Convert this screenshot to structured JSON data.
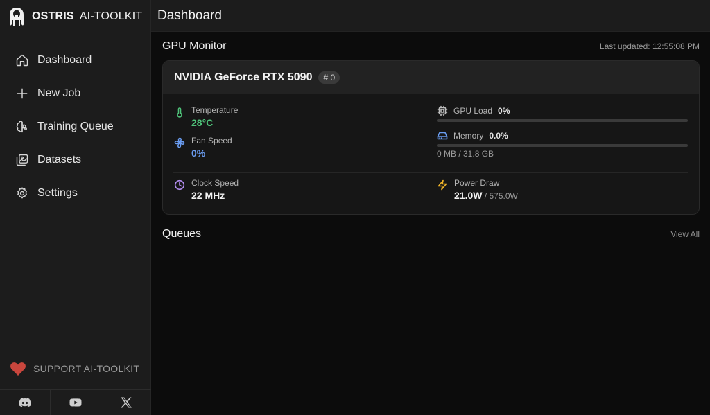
{
  "brand": {
    "name": "OSTRIS",
    "sub": "AI-TOOLKIT"
  },
  "header": {
    "title": "Dashboard"
  },
  "sidebar": {
    "items": [
      {
        "label": "Dashboard",
        "icon": "home-icon"
      },
      {
        "label": "New Job",
        "icon": "plus-icon"
      },
      {
        "label": "Training Queue",
        "icon": "brain-icon"
      },
      {
        "label": "Datasets",
        "icon": "images-icon"
      },
      {
        "label": "Settings",
        "icon": "gear-icon"
      }
    ],
    "support_label": "SUPPORT AI-TOOLKIT",
    "footer_icons": [
      "discord-icon",
      "youtube-icon",
      "x-icon"
    ]
  },
  "gpu_monitor": {
    "title": "GPU Monitor",
    "last_updated": "Last updated: 12:55:08 PM",
    "gpu": {
      "name": "NVIDIA GeForce RTX 5090",
      "index_badge": "# 0",
      "temperature": {
        "label": "Temperature",
        "value": "28°C"
      },
      "fan_speed": {
        "label": "Fan Speed",
        "value": "0%"
      },
      "gpu_load": {
        "label": "GPU Load",
        "value": "0%",
        "fraction": 0.0
      },
      "memory": {
        "label": "Memory",
        "value": "0.0%",
        "fraction": 0.0,
        "detail": "0 MB / 31.8 GB"
      },
      "clock_speed": {
        "label": "Clock Speed",
        "value": "22 MHz"
      },
      "power_draw": {
        "label": "Power Draw",
        "value": "21.0W",
        "max": " / 575.0W"
      }
    }
  },
  "queues": {
    "title": "Queues",
    "view_all": "View All"
  },
  "colors": {
    "temperature": "#4fc37a",
    "fan": "#6a9cf0",
    "clock": "#b38df0",
    "power": "#f0b429",
    "heart": "#c9463d"
  }
}
